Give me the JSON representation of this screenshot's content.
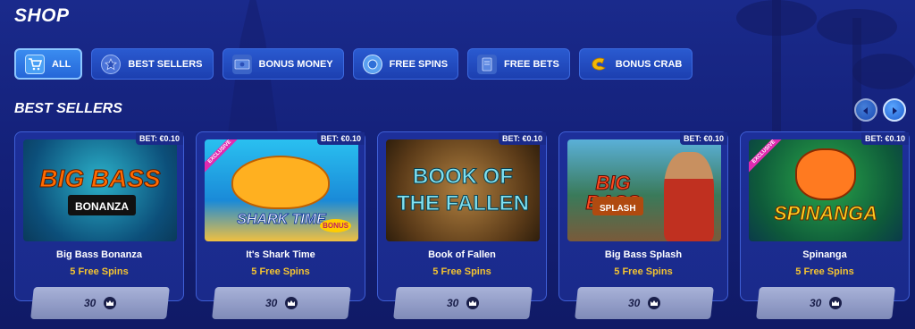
{
  "page": {
    "title": "SHOP"
  },
  "filters": [
    {
      "label": "ALL",
      "icon": "cart-icon",
      "active": true
    },
    {
      "label": "BEST SELLERS",
      "icon": "star-icon",
      "active": false
    },
    {
      "label": "BONUS MONEY",
      "icon": "money-icon",
      "active": false
    },
    {
      "label": "FREE SPINS",
      "icon": "spin-coin-icon",
      "active": false
    },
    {
      "label": "FREE BETS",
      "icon": "ticket-icon",
      "active": false
    },
    {
      "label": "BONUS CRAB",
      "icon": "crab-claw-icon",
      "active": false
    }
  ],
  "section": {
    "title": "BEST SELLERS"
  },
  "cards": [
    {
      "name": "Big Bass Bonanza",
      "offer": "5 Free Spins",
      "bet": "BET: €0.10",
      "price": "30",
      "exclusive": false,
      "thumb_line1": "BIG BASS",
      "thumb_line2": "BONANZA"
    },
    {
      "name": "It's Shark Time",
      "offer": "5 Free Spins",
      "bet": "BET: €0.10",
      "price": "30",
      "exclusive": true,
      "exclusive_label": "EXCLUSIVE",
      "thumb_line1": "SHARK TIME",
      "thumb_line2": "BONUS"
    },
    {
      "name": "Book of Fallen",
      "offer": "5 Free Spins",
      "bet": "BET: €0.10",
      "price": "30",
      "exclusive": false,
      "thumb_line1": "BOOK OF",
      "thumb_line2": "THE FALLEN"
    },
    {
      "name": "Big Bass Splash",
      "offer": "5 Free Spins",
      "bet": "BET: €0.10",
      "price": "30",
      "exclusive": false,
      "thumb_line1": "BIG BASS",
      "thumb_line2": "SPLASH"
    },
    {
      "name": "Spinanga",
      "offer": "5 Free Spins",
      "bet": "BET: €0.10",
      "price": "30",
      "exclusive": true,
      "exclusive_label": "EXCLUSIVE",
      "thumb_line1": "SPINANGA",
      "thumb_line2": ""
    }
  ],
  "colors": {
    "background": "#14217a",
    "accent": "#2566d8",
    "offer": "#f4c430",
    "exclusive": "#e02bb0"
  }
}
